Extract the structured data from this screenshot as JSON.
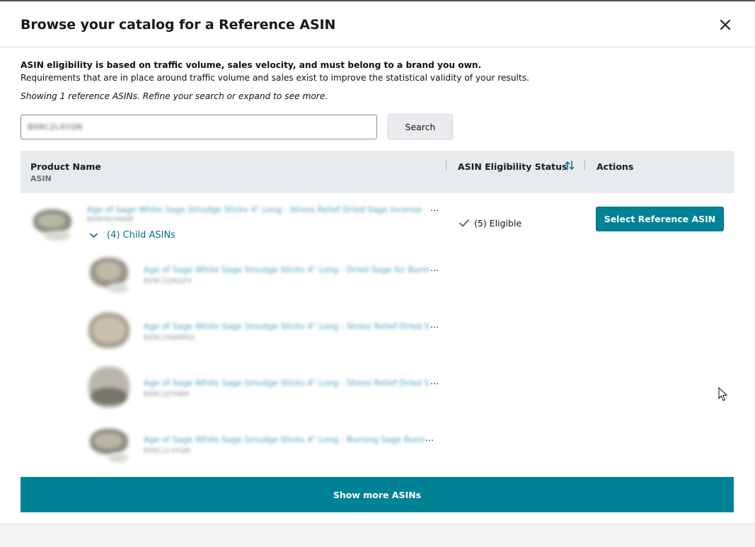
{
  "modal": {
    "title": "Browse your catalog for a Reference ASIN",
    "close_icon": "close-icon"
  },
  "info": {
    "requirement_bold": "ASIN eligibility is based on traffic volume, sales velocity, and must belong to a brand you own.",
    "requirement_text": "Requirements that are in place around traffic volume and sales exist to improve the statistical validity of your results.",
    "showing_text": "Showing 1 reference ASINs. Refine your search or expand to see more."
  },
  "search": {
    "value": "B09C2L4YQN",
    "button_label": "Search"
  },
  "table": {
    "columns": {
      "product_name": "Product Name",
      "asin": "ASIN",
      "eligibility_status": "ASIN Eligibility Status",
      "actions": "Actions"
    },
    "sort_icon": "sort-icon",
    "parent": {
      "name": "Age of Sage White Sage Smudge Sticks 4\" Long - Stress Relief Dried Sage Incense",
      "asin": "B09FKCHN6R",
      "child_toggle_label": "(4) Child ASINs",
      "status": "(5) Eligible",
      "action_label": "Select Reference ASIN"
    },
    "children": [
      {
        "name": "Age of Sage White Sage Smudge Sticks 4\" Long - Dried Sage for Burning",
        "asin": "B09C1Q6GZ4"
      },
      {
        "name": "Age of Sage White Sage Smudge Sticks 4\" Long - Stress Relief Dried Sage",
        "asin": "B09C2KWMRQ"
      },
      {
        "name": "Age of Sage White Sage Smudge Sticks 4\" Long - Stress Relief Dried Sage",
        "asin": "B09C2J7H8M"
      },
      {
        "name": "Age of Sage White Sage Smudge Sticks 4\" Long - Burning Sage Bundles",
        "asin": "B09C2L4YQN"
      }
    ]
  },
  "show_more_label": "Show more ASINs",
  "colors": {
    "accent": "#008296",
    "link": "#007185",
    "header_bg": "#e8ebee"
  }
}
